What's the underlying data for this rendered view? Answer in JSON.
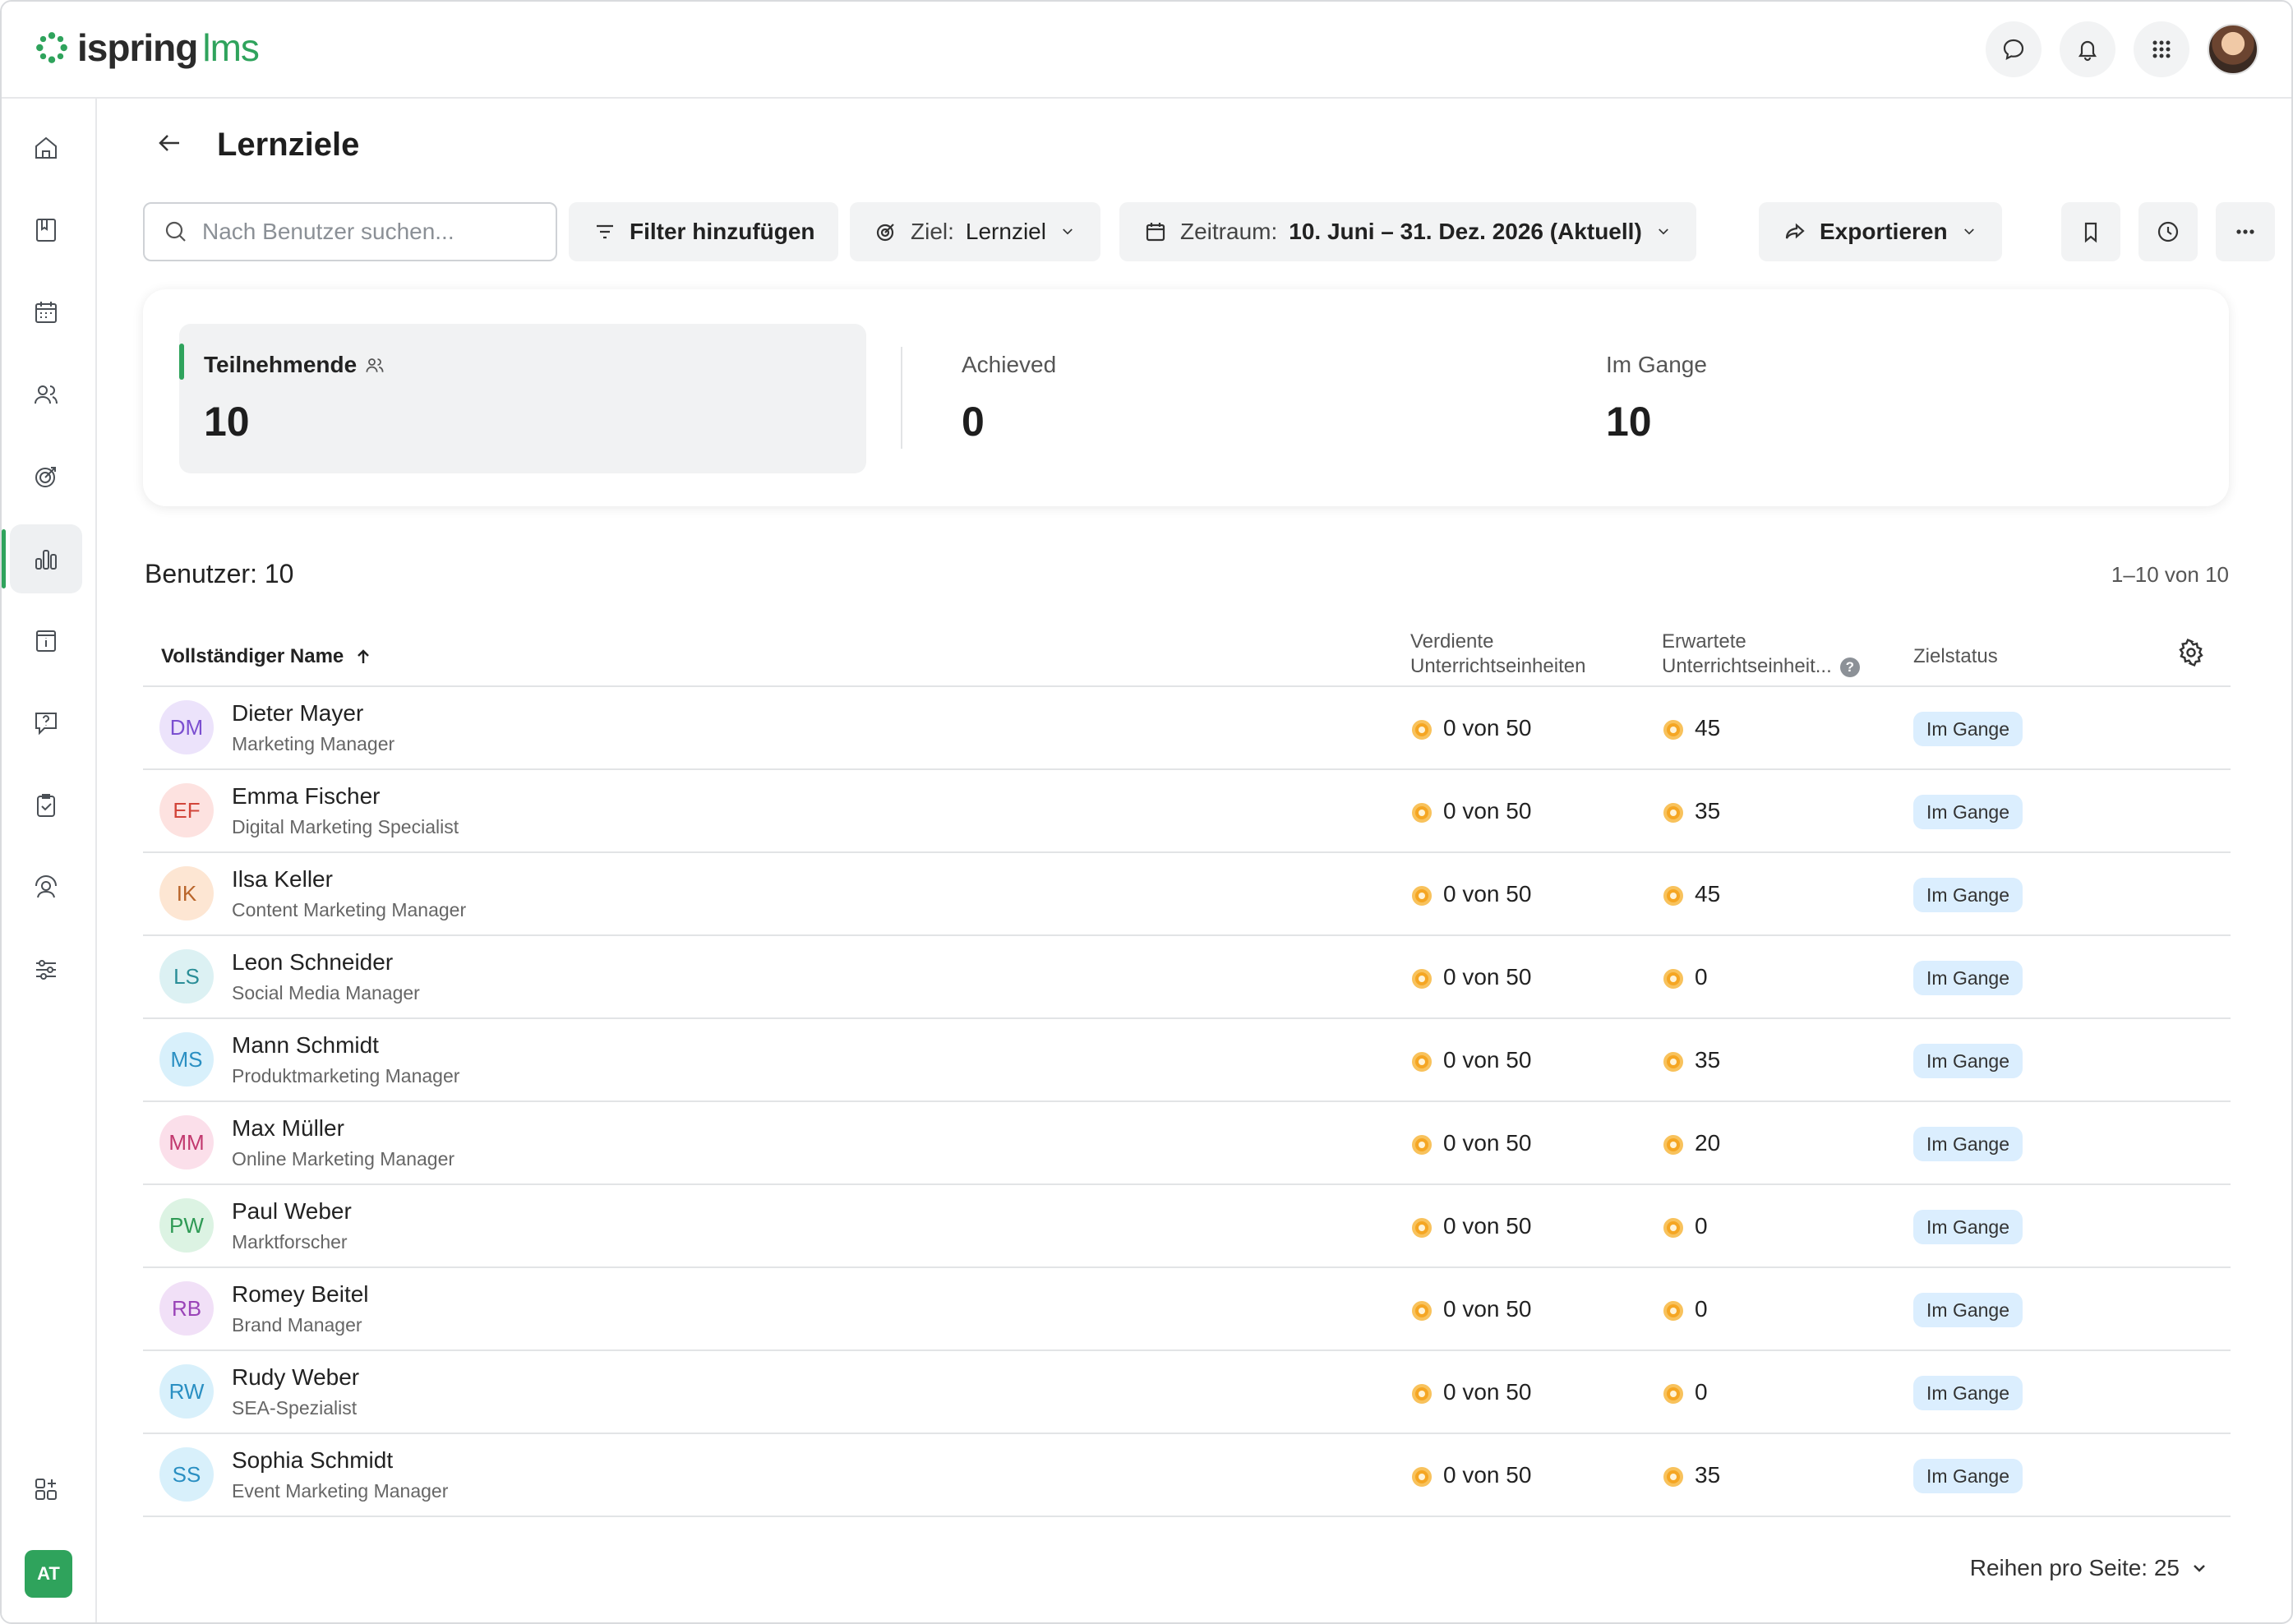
{
  "app": {
    "logo_main": "ispring",
    "logo_accent": "lms"
  },
  "page": {
    "title": "Lernziele"
  },
  "search": {
    "placeholder": "Nach Benutzer suchen..."
  },
  "toolbar": {
    "filter_label": "Filter hinzufügen",
    "goal_prefix": "Ziel:",
    "goal_value": "Lernziel",
    "period_prefix": "Zeitraum:",
    "period_value": "10. Juni – 31. Dez. 2026 (Aktuell)",
    "export_label": "Exportieren"
  },
  "stats": {
    "participants_label": "Teilnehmende",
    "participants_value": "10",
    "achieved_label": "Achieved",
    "achieved_value": "0",
    "in_progress_label": "Im Gange",
    "in_progress_value": "10"
  },
  "users_count": "Benutzer: 10",
  "pager_range": "1–10 von 10",
  "table": {
    "col_name": "Vollständiger Name",
    "col_earned_1": "Verdiente",
    "col_earned_2": "Unterrichtseinheiten",
    "col_expected_1": "Erwartete",
    "col_expected_2": "Unterrichtseinheit...",
    "col_status": "Zielstatus",
    "rows": [
      {
        "initials": "DM",
        "name": "Dieter Mayer",
        "role": "Marketing Manager",
        "earned": "0 von 50",
        "expected": "45",
        "status": "Im Gange",
        "bg": "#ece3fb",
        "fg": "#7b4fd0"
      },
      {
        "initials": "EF",
        "name": "Emma Fischer",
        "role": "Digital Marketing Specialist",
        "earned": "0 von 50",
        "expected": "35",
        "status": "Im Gange",
        "bg": "#fde2e0",
        "fg": "#d2453a"
      },
      {
        "initials": "IK",
        "name": "Ilsa Keller",
        "role": "Content Marketing Manager",
        "earned": "0 von 50",
        "expected": "45",
        "status": "Im Gange",
        "bg": "#fde6d3",
        "fg": "#b9652a"
      },
      {
        "initials": "LS",
        "name": "Leon Schneider",
        "role": "Social Media Manager",
        "earned": "0 von 50",
        "expected": "0",
        "status": "Im Gange",
        "bg": "#dcf1f3",
        "fg": "#2a8e97"
      },
      {
        "initials": "MS",
        "name": "Mann Schmidt",
        "role": "Produktmarketing Manager",
        "earned": "0 von 50",
        "expected": "35",
        "status": "Im Gange",
        "bg": "#d8f0fb",
        "fg": "#2a8fc2"
      },
      {
        "initials": "MM",
        "name": "Max Müller",
        "role": "Online Marketing Manager",
        "earned": "0 von 50",
        "expected": "20",
        "status": "Im Gange",
        "bg": "#fbdfea",
        "fg": "#c2386e"
      },
      {
        "initials": "PW",
        "name": "Paul Weber",
        "role": "Marktforscher",
        "earned": "0 von 50",
        "expected": "0",
        "status": "Im Gange",
        "bg": "#dcf3e3",
        "fg": "#2f9a55"
      },
      {
        "initials": "RB",
        "name": "Romey Beitel",
        "role": "Brand Manager",
        "earned": "0 von 50",
        "expected": "0",
        "status": "Im Gange",
        "bg": "#f1e0f7",
        "fg": "#9a44b8"
      },
      {
        "initials": "RW",
        "name": "Rudy Weber",
        "role": "SEA-Spezialist",
        "earned": "0 von 50",
        "expected": "0",
        "status": "Im Gange",
        "bg": "#d8f0fb",
        "fg": "#2a8fc2"
      },
      {
        "initials": "SS",
        "name": "Sophia Schmidt",
        "role": "Event Marketing Manager",
        "earned": "0 von 50",
        "expected": "35",
        "status": "Im Gange",
        "bg": "#d8f0fb",
        "fg": "#2a8fc2"
      }
    ]
  },
  "footer": {
    "rows_per_page": "Reihen pro Seite: 25"
  },
  "sidebar": {
    "items": [
      "home-icon",
      "book-icon",
      "calendar-icon",
      "users-icon",
      "target-icon",
      "reports-icon",
      "info-icon",
      "question-icon",
      "clipboard-icon",
      "user-support-icon",
      "sliders-icon"
    ],
    "active": "reports-icon",
    "bottom": [
      "add-widgets-icon"
    ],
    "user_badge": "AT"
  },
  "colors": {
    "accent": "#2fa35c",
    "badge": "#dbeefe",
    "coin": "#f5a623"
  }
}
